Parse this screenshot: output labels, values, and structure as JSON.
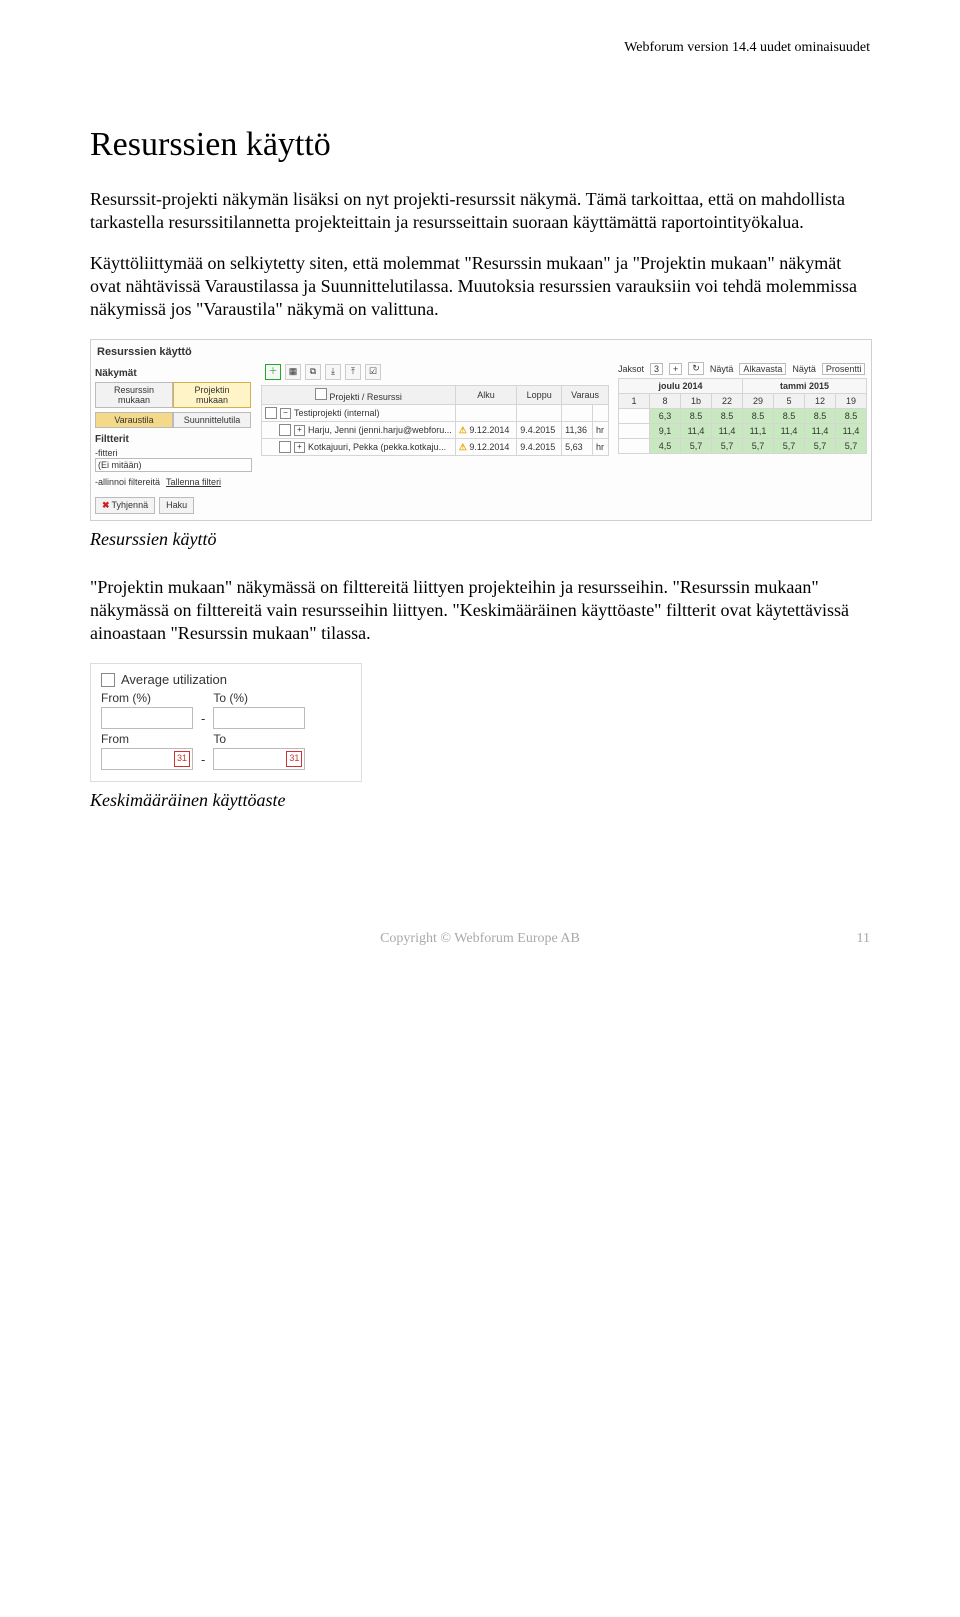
{
  "header": {
    "product": "Webforum version 14.4 uudet ominaisuudet"
  },
  "title": "Resurssien käyttö",
  "p1": "Resurssit-projekti näkymän lisäksi on nyt projekti-resurssit näkymä. Tämä tarkoittaa, että on mahdollista tarkastella resurssitilannetta projekteittain ja resursseittain suoraan käyttämättä raportointityökalua.",
  "p2": "Käyttöliittymää on selkiytetty siten, että molemmat \"Resurssin mukaan\" ja \"Projektin mukaan\" näkymät ovat nähtävissä Varaustilassa ja Suunnittelutilassa. Muutoksia resurssien varauksiin voi tehdä molemmissa näkymissä jos \"Varaustila\" näkymä on valittuna.",
  "caption1": "Resurssien käyttö",
  "p3": "\"Projektin mukaan\" näkymässä on filttereitä liittyen projekteihin ja resursseihin. \"Resurssin mukaan\" näkymässä on filttereitä vain resursseihin liittyen. \"Keskimääräinen käyttöaste\" filtterit ovat käytettävissä ainoastaan \"Resurssin mukaan\" tilassa.",
  "caption2": "Keskimääräinen käyttöaste",
  "footer": {
    "copyright": "Copyright © Webforum Europe AB",
    "page": "11"
  },
  "shot1": {
    "appTitle": "Resurssien käyttö",
    "leftLabels": {
      "nakhymat": "Näkymät",
      "filterit": "Filtterit",
      "aihepiiri": "-fitteri",
      "none": "(Ei mitään)",
      "hallinnoi": "-allinnoi filtereitä",
      "tallenna": "Tallenna filteri"
    },
    "tabs": {
      "resurssin": "Resurssin mukaan",
      "projektin": "Projektin mukaan",
      "varaustila": "Varaustila",
      "suunnittelu": "Suunnittelutila"
    },
    "buttons": {
      "tyhjenna": "Tyhjennä",
      "haku": "Haku"
    },
    "columns": {
      "projekti": "Projekti / Resurssi",
      "alku": "Alku",
      "loppu": "Loppu",
      "varaus": "Varaus"
    },
    "tree": {
      "root": "Testiprojekti (internal)",
      "r1": {
        "name": "Harju, Jenni (jenni.harju@webforu...",
        "alku": "9.12.2014",
        "loppu": "9.4.2015",
        "varaus": "11,36",
        "unit": "hr"
      },
      "r2": {
        "name": "Kotkajuuri, Pekka (pekka.kotkaju...",
        "alku": "9.12.2014",
        "loppu": "9.4.2015",
        "varaus": "5,63",
        "unit": "hr"
      }
    },
    "rightHeader": {
      "jaksot": "Jaksot",
      "jaksotVal": "3",
      "nayta": "Näytä",
      "naytaSel": "Alkavasta",
      "unit": "Näytä",
      "unitSel": "Prosentti"
    },
    "months": {
      "m1": "joulu 2014",
      "m2": "tammi 2015"
    },
    "weeks": [
      "1",
      "8",
      "1b",
      "22",
      "29",
      "5",
      "12",
      "19"
    ],
    "rows": {
      "r1": [
        "6,3",
        "8.5",
        "8.5",
        "8.5",
        "8.5",
        "8.5",
        "8.5"
      ],
      "r2": [
        "9,1",
        "11,4",
        "11,4",
        "11,1",
        "11,4",
        "11,4",
        "11,4"
      ],
      "r3": [
        "4,5",
        "5,7",
        "5,7",
        "5,7",
        "5,7",
        "5,7",
        "5,7"
      ]
    }
  },
  "shot2": {
    "title": "Average utilization",
    "fromPct": "From (%)",
    "toPct": "To (%)",
    "from": "From",
    "to": "To",
    "cal": "31"
  }
}
